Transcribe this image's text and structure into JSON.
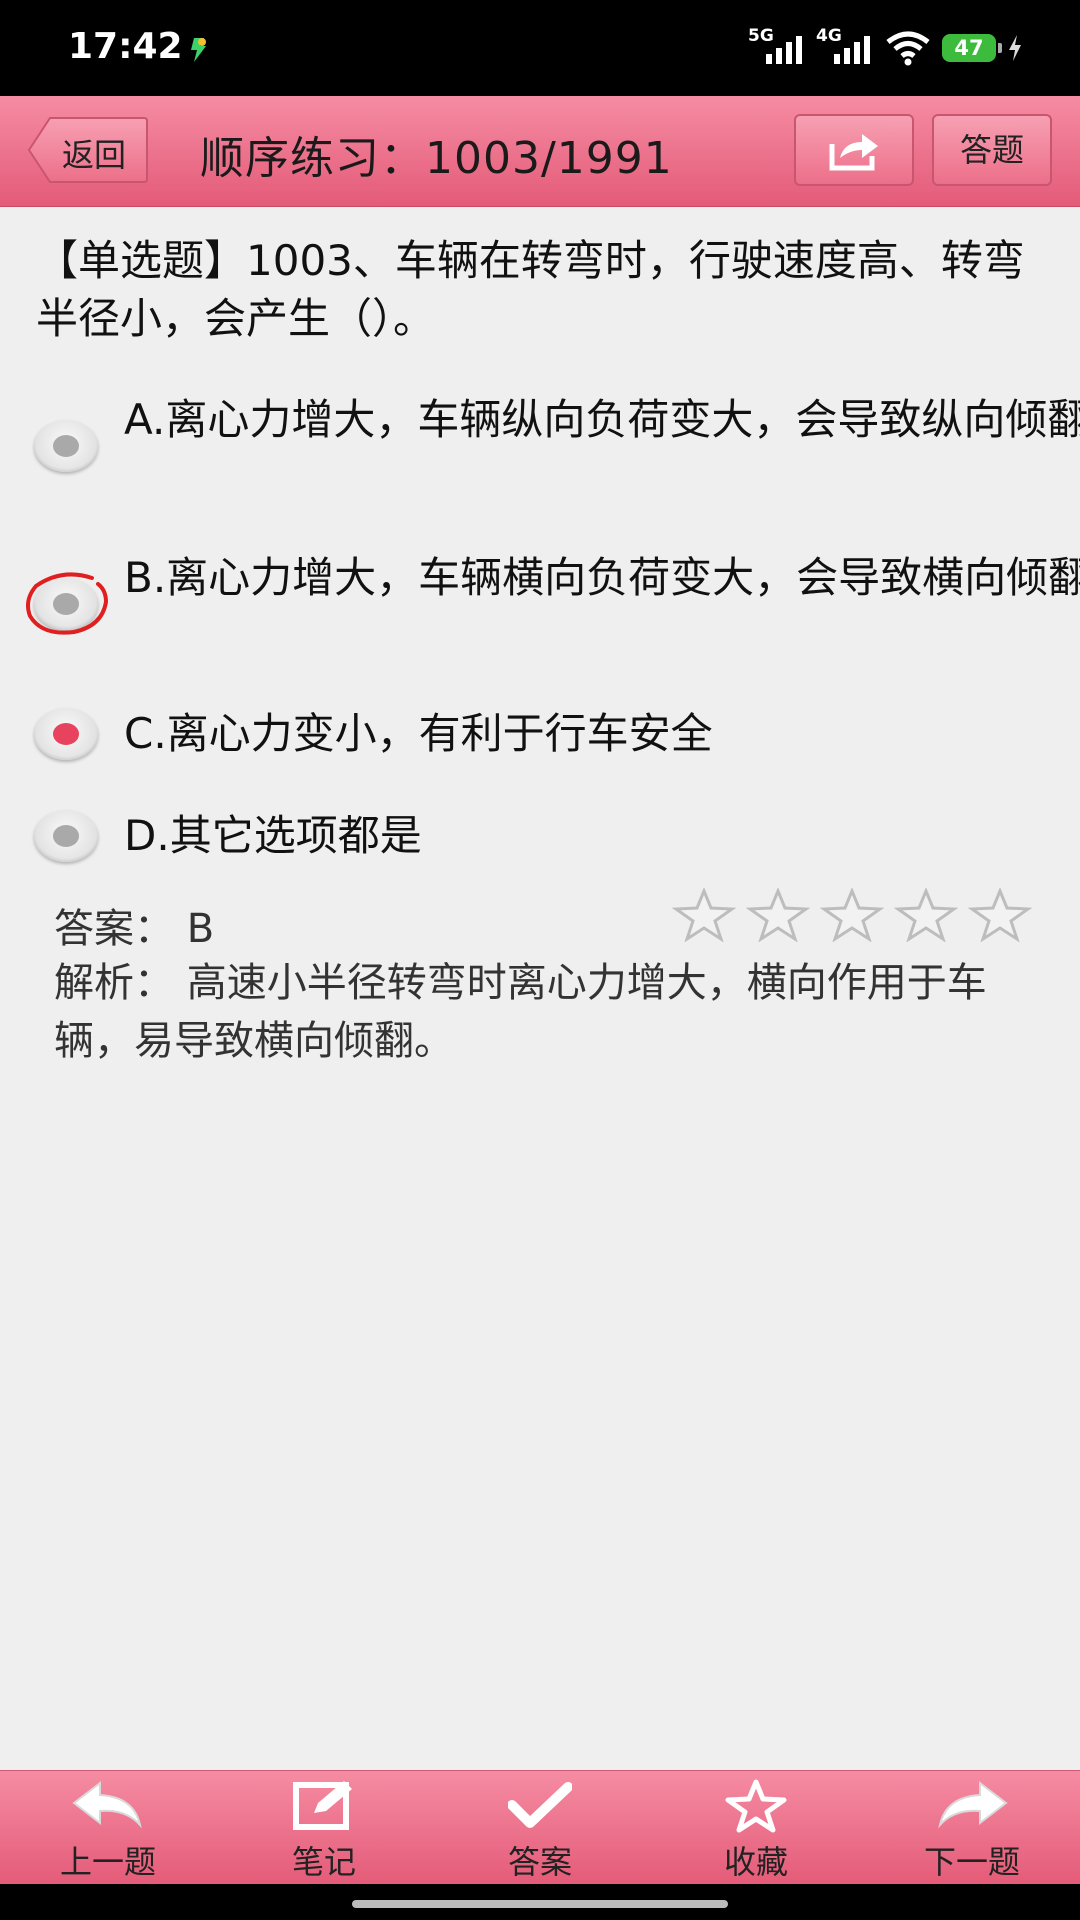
{
  "status_bar": {
    "time": "17:42",
    "signal1_label": "5G",
    "signal2_label": "4G",
    "battery": "47",
    "icons": [
      "app-notification-icon",
      "signal-5g-icon",
      "signal-4g-icon",
      "wifi-icon",
      "battery-icon",
      "charging-icon"
    ]
  },
  "header": {
    "back_label": "返回",
    "title": "顺序练习：1003/1991",
    "share_icon": "share-icon",
    "answer_button_label": "答题"
  },
  "question": {
    "text": "【单选题】1003、车辆在转弯时，行驶速度高、转弯半径小，会产生（）。",
    "options": [
      {
        "label": "A.离心力增大，车辆纵向负荷变大，会导致纵向倾翻",
        "selected": false
      },
      {
        "label": "B.离心力增大，车辆横向负荷变大，会导致横向倾翻",
        "selected": false,
        "marked": true
      },
      {
        "label": "C.离心力变小，有利于行车安全",
        "selected": true
      },
      {
        "label": "D.其它选项都是",
        "selected": false
      }
    ]
  },
  "answer": {
    "answer_text": "答案：  B",
    "rating": 0,
    "rating_max": 5,
    "analysis_text": "解析：  高速小半径转弯时离心力增大，横向作用于车辆，易导致横向倾翻。"
  },
  "toolbar": {
    "items": [
      {
        "label": "上一题",
        "icon": "previous-arrow-icon"
      },
      {
        "label": "笔记",
        "icon": "note-edit-icon"
      },
      {
        "label": "答案",
        "icon": "checkmark-icon"
      },
      {
        "label": "收藏",
        "icon": "star-icon"
      },
      {
        "label": "下一题",
        "icon": "next-arrow-icon"
      }
    ]
  },
  "colors": {
    "accent_pink": "#e45b78",
    "selected_dot": "#e8435e",
    "battery_green": "#3dbb3d"
  }
}
